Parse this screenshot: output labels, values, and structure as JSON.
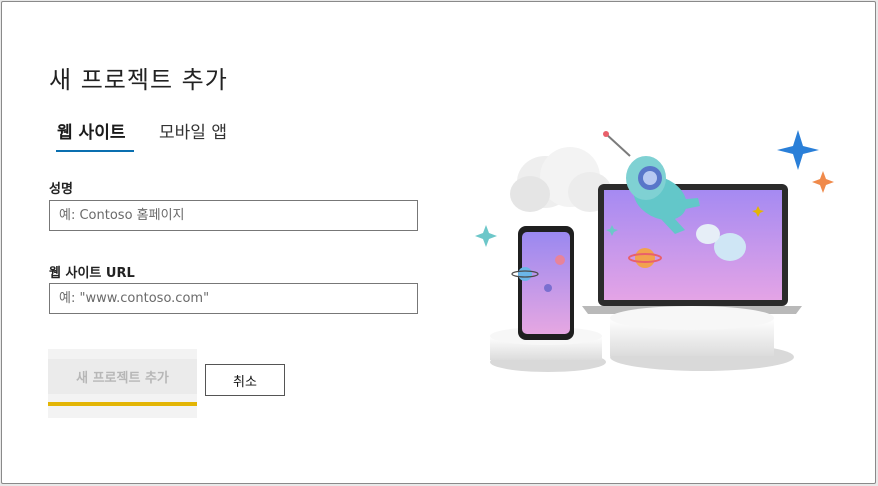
{
  "dialog": {
    "title": "새 프로젝트 추가",
    "tabs": [
      {
        "label": "웹 사이트",
        "active": true
      },
      {
        "label": "모바일 앱",
        "active": false
      }
    ],
    "fields": {
      "name": {
        "label": "성명",
        "placeholder": "예: Contoso 홈페이지",
        "value": ""
      },
      "url": {
        "label": "웹 사이트 URL",
        "placeholder": "예: \"www.contoso.com\"",
        "value": ""
      }
    },
    "buttons": {
      "add_label": "새 프로젝트 추가",
      "cancel_label": "취소"
    },
    "colors": {
      "tab_underline": "#0a6fb0",
      "focus_bar": "#e3b505",
      "sparkle_blue": "#2a7fd8",
      "sparkle_orange": "#f08a4b",
      "sparkle_teal": "#6cc7c9"
    },
    "illustration_icon": "rocket-and-devices-illustration"
  }
}
